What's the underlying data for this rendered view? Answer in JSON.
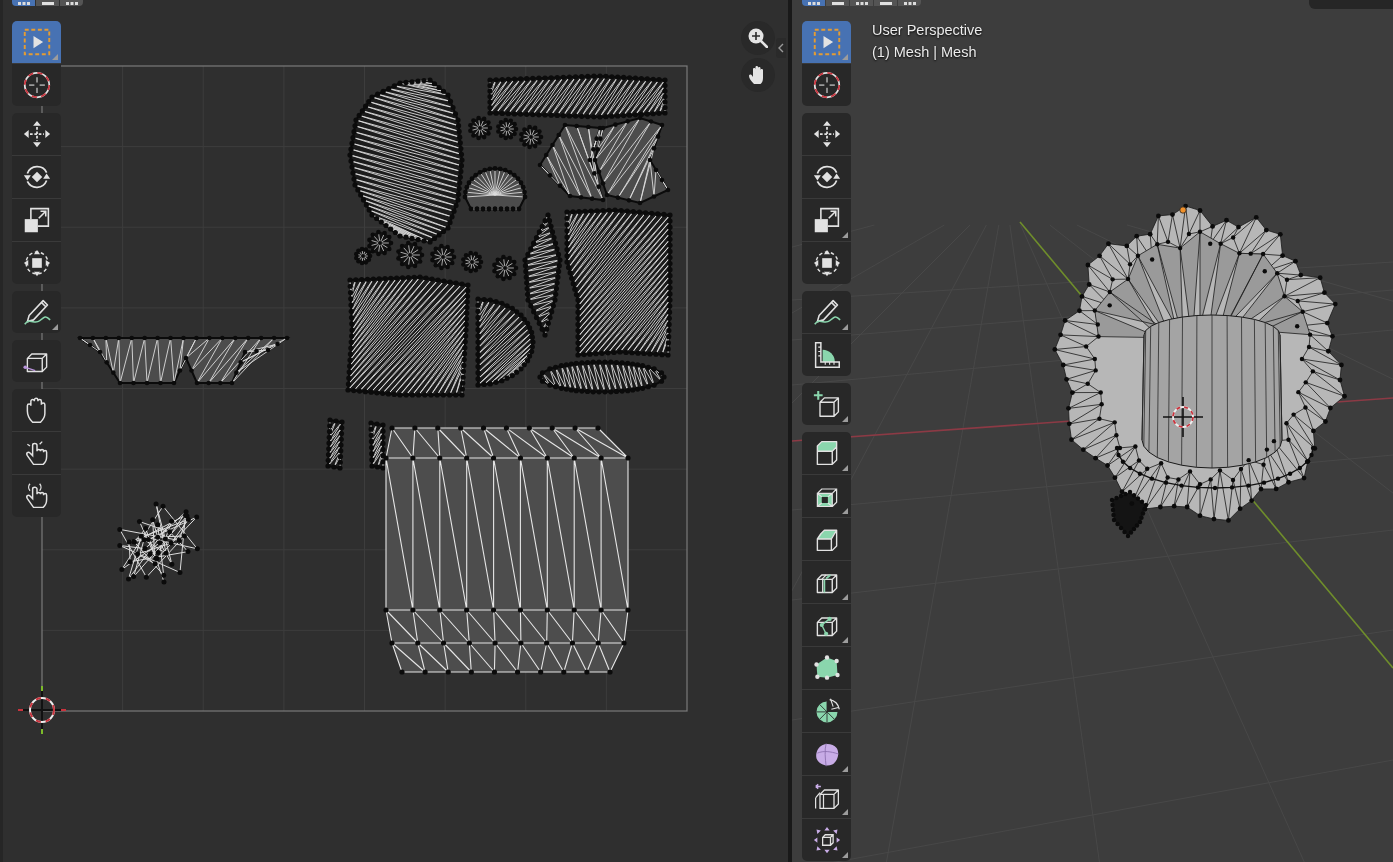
{
  "uv_editor": {
    "select_modes": [
      {
        "kind": "dots",
        "selected": true
      },
      {
        "kind": "block",
        "selected": false
      },
      {
        "kind": "dots",
        "selected": false
      }
    ],
    "toolbar": [
      {
        "tools": [
          {
            "kind": "select-box",
            "selected": true,
            "submenu": true
          },
          {
            "kind": "cursor",
            "selected": false,
            "submenu": false
          }
        ]
      },
      {
        "tools": [
          {
            "kind": "move",
            "selected": false,
            "submenu": false
          },
          {
            "kind": "rotate",
            "selected": false,
            "submenu": false
          },
          {
            "kind": "scale",
            "selected": false,
            "submenu": false
          },
          {
            "kind": "transform",
            "selected": false,
            "submenu": false
          }
        ]
      },
      {
        "tools": [
          {
            "kind": "annotate",
            "selected": false,
            "submenu": true
          }
        ]
      },
      {
        "tools": [
          {
            "kind": "rip",
            "selected": false,
            "submenu": false
          }
        ]
      },
      {
        "tools": [
          {
            "kind": "grab",
            "selected": false,
            "submenu": false
          },
          {
            "kind": "relax",
            "selected": false,
            "submenu": false
          },
          {
            "kind": "pinch",
            "selected": false,
            "submenu": false
          }
        ]
      }
    ]
  },
  "viewport": {
    "select_modes": [
      {
        "kind": "dots",
        "selected": true
      },
      {
        "kind": "block",
        "selected": false
      },
      {
        "kind": "dots",
        "selected": false
      },
      {
        "kind": "block",
        "selected": false
      },
      {
        "kind": "dots",
        "selected": false
      }
    ],
    "header": {
      "title": "User Perspective",
      "subtitle": "(1) Mesh | Mesh"
    },
    "toolbar": [
      {
        "tools": [
          {
            "kind": "select-box",
            "selected": true,
            "submenu": true
          },
          {
            "kind": "cursor",
            "selected": false,
            "submenu": false
          }
        ]
      },
      {
        "tools": [
          {
            "kind": "move",
            "selected": false,
            "submenu": false
          },
          {
            "kind": "rotate",
            "selected": false,
            "submenu": false
          },
          {
            "kind": "scale",
            "selected": false,
            "submenu": true
          },
          {
            "kind": "transform",
            "selected": false,
            "submenu": false
          }
        ]
      },
      {
        "tools": [
          {
            "kind": "annotate",
            "selected": false,
            "submenu": true
          },
          {
            "kind": "measure",
            "selected": false,
            "submenu": false
          }
        ]
      },
      {
        "tools": [
          {
            "kind": "add-cube",
            "selected": false,
            "submenu": true
          }
        ]
      },
      {
        "tools": [
          {
            "kind": "extrude",
            "selected": false,
            "submenu": true
          },
          {
            "kind": "inset",
            "selected": false,
            "submenu": true
          },
          {
            "kind": "bevel",
            "selected": false,
            "submenu": false
          },
          {
            "kind": "loop-cut",
            "selected": false,
            "submenu": true
          },
          {
            "kind": "knife",
            "selected": false,
            "submenu": true
          },
          {
            "kind": "poly-build",
            "selected": false,
            "submenu": false
          },
          {
            "kind": "spin",
            "selected": false,
            "submenu": false
          },
          {
            "kind": "smooth",
            "selected": false,
            "submenu": true
          },
          {
            "kind": "edge-slide",
            "selected": false,
            "submenu": true
          },
          {
            "kind": "shrink-fatten",
            "selected": false,
            "submenu": true
          }
        ]
      }
    ]
  }
}
